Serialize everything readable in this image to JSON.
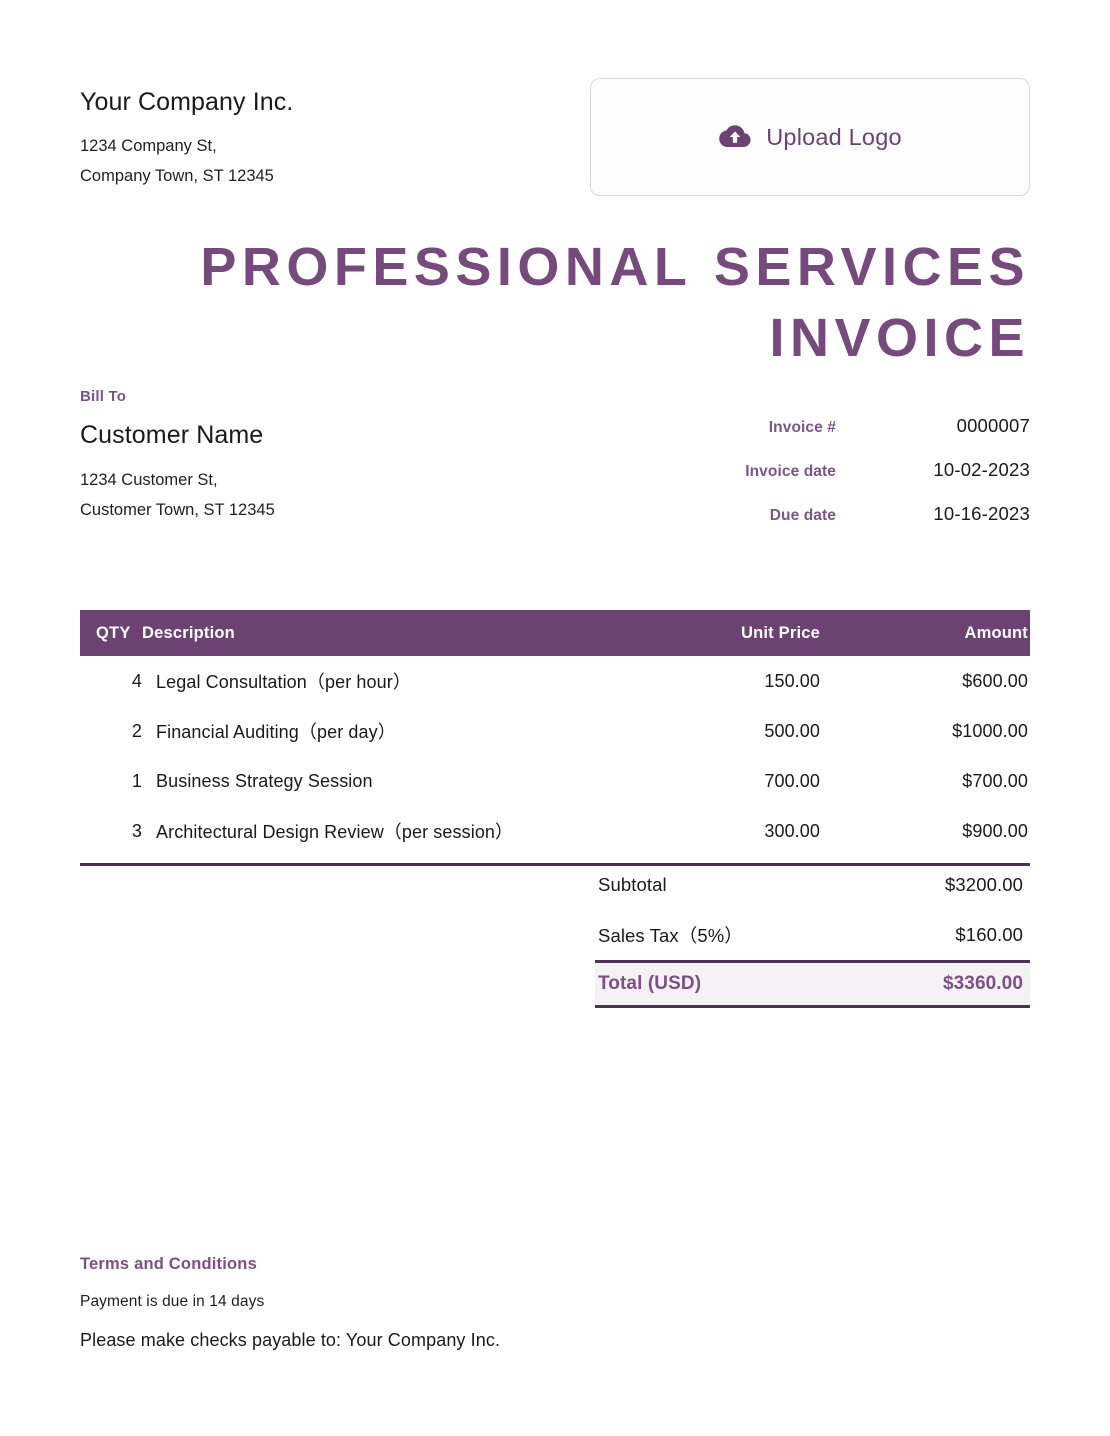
{
  "document": {
    "title": "PROFESSIONAL SERVICES INVOICE",
    "accent_color": "#6b4272",
    "title_color": "#774a7e",
    "label_color": "#7d5487",
    "background_color": "#ffffff"
  },
  "sender": {
    "name": "Your Company Inc.",
    "address": "1234 Company St,\nCompany Town, ST 12345"
  },
  "logo_upload": {
    "label": "Upload Logo",
    "icon": "cloud-upload-icon"
  },
  "bill_to": {
    "label": "Bill To",
    "customer_name": "Customer Name",
    "address": "1234 Customer St,\nCustomer Town, ST 12345"
  },
  "meta": [
    {
      "key": "Invoice #",
      "value": "0000007"
    },
    {
      "key": "Invoice date",
      "value": "10-02-2023"
    },
    {
      "key": "Due date",
      "value": "10-16-2023"
    }
  ],
  "table": {
    "headers": {
      "qty": "QTY",
      "description": "Description",
      "unit_price": "Unit Price",
      "amount": "Amount"
    },
    "rows": [
      {
        "qty": "4",
        "description": "Legal Consultation（per hour）",
        "unit_price": "150.00",
        "amount": "$600.00"
      },
      {
        "qty": "2",
        "description": "Financial Auditing（per day）",
        "unit_price": "500.00",
        "amount": "$1000.00"
      },
      {
        "qty": "1",
        "description": "Business Strategy Session",
        "unit_price": "700.00",
        "amount": "$700.00"
      },
      {
        "qty": "3",
        "description": "Architectural Design Review（per session）",
        "unit_price": "300.00",
        "amount": "$900.00"
      }
    ]
  },
  "totals": [
    {
      "label": "Subtotal",
      "value": "$3200.00"
    },
    {
      "label": "Sales Tax（5%）",
      "value": "$160.00"
    },
    {
      "label": "Total (USD)",
      "value": "$3360.00"
    }
  ],
  "terms": {
    "title": "Terms and Conditions",
    "line1": "Payment is due in 14 days",
    "line2": "Please make checks payable to: Your Company Inc."
  }
}
